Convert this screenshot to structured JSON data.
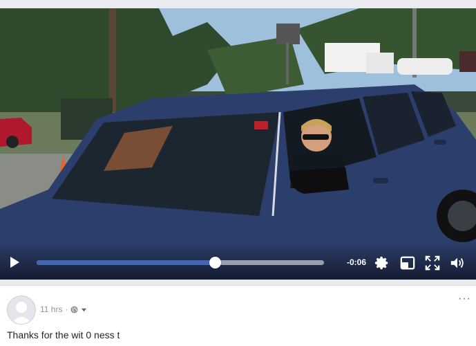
{
  "video": {
    "progress_fraction": 0.62,
    "time_remaining": "-0:06"
  },
  "post": {
    "timestamp": "11 hrs",
    "separator": "·",
    "text": "Thanks for the wit 0 ness t",
    "more_label": "···"
  },
  "colors": {
    "progress_fill": "#4267b2",
    "car_body": "#2c3e6b",
    "page_background": "#e9ebee"
  },
  "icons": {
    "play": "play-icon",
    "settings": "gear-icon",
    "pip": "picture-in-picture-icon",
    "fullscreen": "fullscreen-icon",
    "volume": "volume-icon",
    "audience": "globe-icon",
    "menu": "chevron-down-icon"
  }
}
